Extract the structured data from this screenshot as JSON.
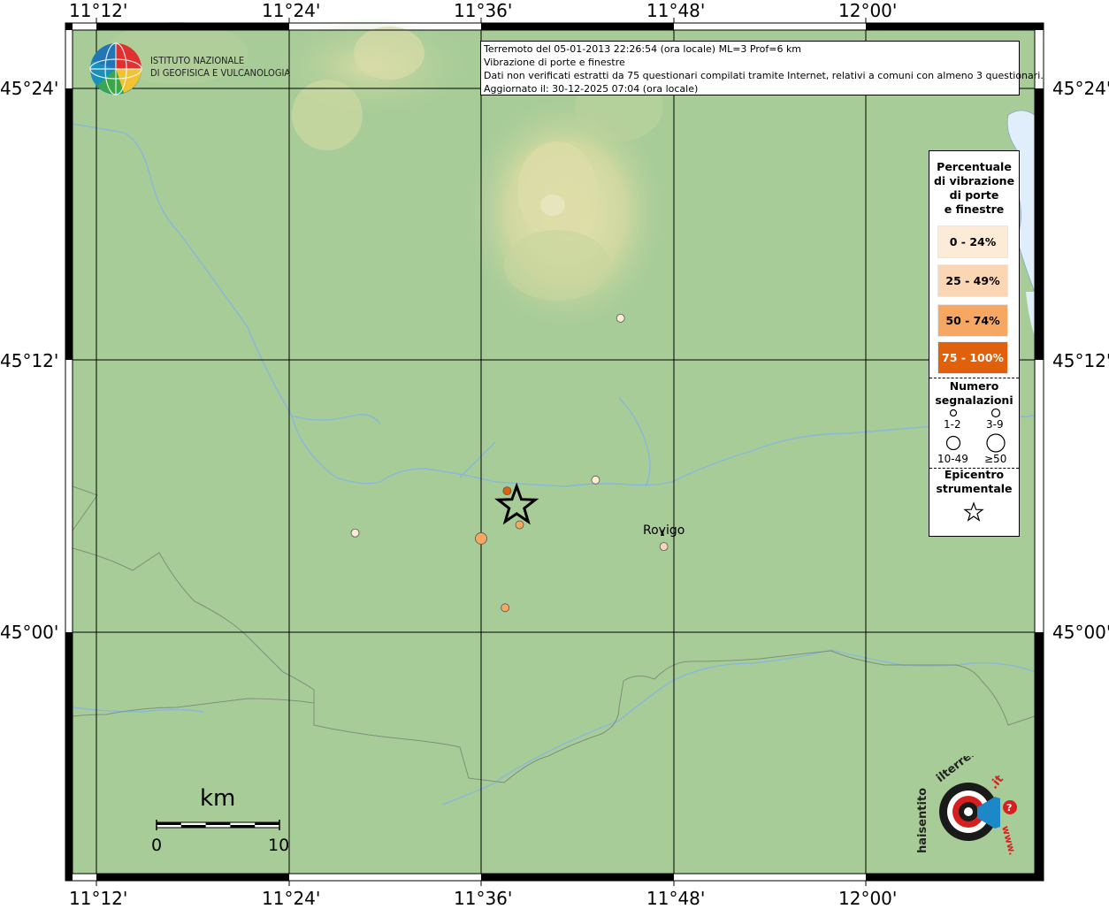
{
  "map": {
    "lon_ticks": [
      "11°12'",
      "11°24'",
      "11°36'",
      "11°48'",
      "12°00'"
    ],
    "lat_ticks": [
      "45°24'",
      "45°12'",
      "45°00'"
    ],
    "colors": {
      "plain": "#a8cc98",
      "hills": "#c9d69a",
      "river": "#7fb0d8",
      "sea": "#dfeefa"
    }
  },
  "logo": {
    "line1": "ISTITUTO NAZIONALE",
    "line2": "DI GEOFISICA E VULCANOLOGIA"
  },
  "header": {
    "line1": "Terremoto del 05-01-2013 22:26:54 (ora locale) ML=3 Prof=6 km",
    "line2": "Vibrazione di porte e finestre",
    "line3": "Dati non verificati estratti da 75 questionari compilati tramite Internet, relativi a comuni con almeno 3 questionari.",
    "line4": "Aggiornato il: 30-12-2025 07:04 (ora locale)"
  },
  "legend": {
    "title_lines": [
      "Percentuale",
      "di vibrazione",
      "di porte",
      "e finestre"
    ],
    "classes": [
      {
        "label": "0 - 24%",
        "color": "#fcebd6",
        "text_color": "#000000"
      },
      {
        "label": "25 - 49%",
        "color": "#fbd6b4",
        "text_color": "#000000"
      },
      {
        "label": "50 - 74%",
        "color": "#f6a862",
        "text_color": "#000000"
      },
      {
        "label": "75 - 100%",
        "color": "#e0600c",
        "text_color": "#ffffff"
      }
    ],
    "count_title_lines": [
      "Numero",
      "segnalazioni"
    ],
    "count_classes": [
      "1-2",
      "3-9",
      "10-49",
      "≥50"
    ],
    "epicenter_title_lines": [
      "Epicentro",
      "strumentale"
    ]
  },
  "city": {
    "name": "Rovigo"
  },
  "scalebar": {
    "title": "km",
    "start": "0",
    "end": "10"
  },
  "observations": [
    {
      "lon": 11.745,
      "lat": 45.231,
      "percent_class": "0 - 24%",
      "count_class": "3-9"
    },
    {
      "lon": 11.719,
      "lat": 45.112,
      "percent_class": "0 - 24%",
      "count_class": "3-9"
    },
    {
      "lon": 11.469,
      "lat": 45.073,
      "percent_class": "0 - 24%",
      "count_class": "3-9"
    },
    {
      "lon": 11.6,
      "lat": 45.069,
      "percent_class": "50 - 74%",
      "count_class": "10-49"
    },
    {
      "lon": 11.627,
      "lat": 45.104,
      "percent_class": "75 - 100%",
      "count_class": "3-9"
    },
    {
      "lon": 11.64,
      "lat": 45.079,
      "percent_class": "50 - 74%",
      "count_class": "3-9"
    },
    {
      "lon": 11.625,
      "lat": 45.018,
      "percent_class": "50 - 74%",
      "count_class": "3-9"
    },
    {
      "lon": 11.79,
      "lat": 45.063,
      "percent_class": "25 - 49%",
      "count_class": "3-9"
    }
  ],
  "epicenter": {
    "lon": 11.637,
    "lat": 45.093
  },
  "haisentito_logo": {
    "text": "www.haisentitoilterremoto.it"
  }
}
